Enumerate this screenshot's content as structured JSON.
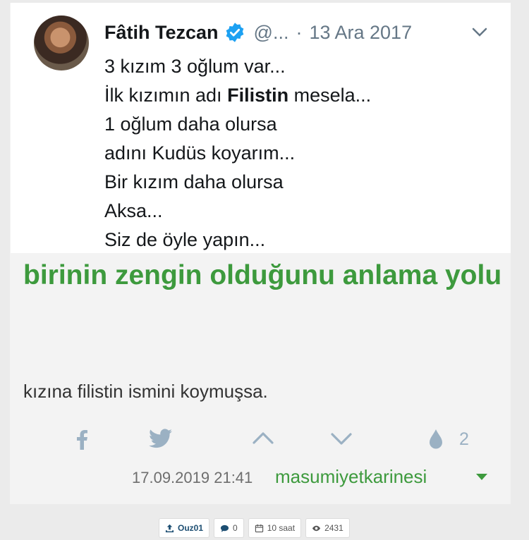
{
  "tweet": {
    "name": "Fâtih Tezcan",
    "handle": "@...",
    "separator": "·",
    "date": "13 Ara 2017",
    "lines": [
      "3 kızım 3 oğlum var...",
      "İlk kızımın adı",
      "Filistin",
      "mesela...",
      "1 oğlum daha olursa",
      "adını Kudüs koyarım...",
      "Bir kızım daha olursa",
      "Aksa...",
      "Siz de öyle yapın..."
    ]
  },
  "topic": {
    "title": "birinin zengin olduğunu anlama yolu",
    "entry_text": "kızına filistin ismini koymuşsa."
  },
  "actions": {
    "favorite_count": "2",
    "icons": [
      "facebook-icon",
      "twitter-icon",
      "upvote-icon",
      "downvote-icon",
      "drop-icon"
    ]
  },
  "footer": {
    "datetime": "17.09.2019 21:41",
    "author": "masumiyetkarinesi"
  },
  "meta": {
    "uploader": "Ouz01",
    "comments": "0",
    "time_ago": "10 saat",
    "views": "2431"
  },
  "colors": {
    "accent_green": "#3d9a3d",
    "twitter_blue": "#1da1f2",
    "icon_gray": "#9bb1c3"
  }
}
